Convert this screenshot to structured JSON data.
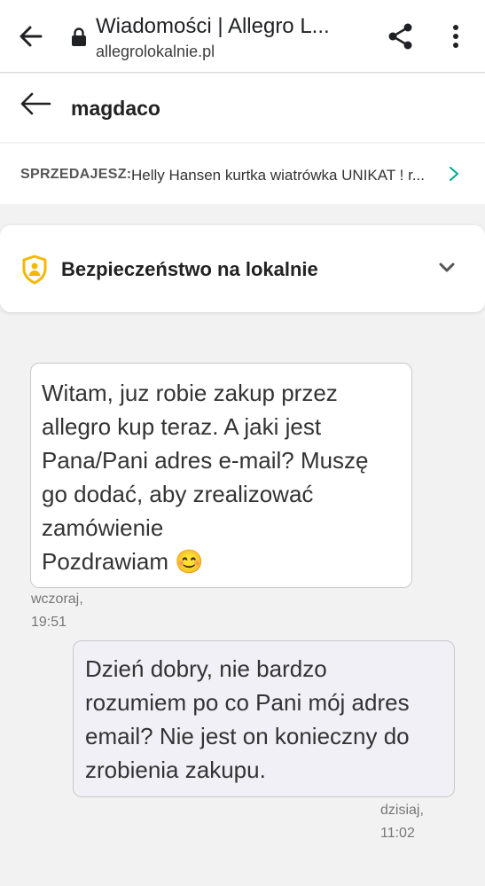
{
  "browser": {
    "title": "Wiadomości | Allegro L...",
    "url": "allegrolokalnie.pl"
  },
  "conversation": {
    "username": "magdaco"
  },
  "seller_bar": {
    "label": "SPRZEDAJESZ:",
    "item": "Helly Hansen kurtka wiatrówka UNIKAT ! r..."
  },
  "safety": {
    "title": "Bezpieczeństwo na lokalnie"
  },
  "messages": [
    {
      "direction": "incoming",
      "text": "Witam, juz robie zakup przez\nallegro kup teraz. A jaki jest\nPana/Pani adres e-mail? Muszę\ngo dodać, aby zrealizować\nzamówienie\nPozdrawiam 😊",
      "time": "wczoraj,\n19:51"
    },
    {
      "direction": "outgoing",
      "text": "Dzień dobry, nie bardzo\nrozumiem po co Pani mój adres\nemail? Nie jest on konieczny do\nzrobienia zakupu.",
      "time": "dzisiaj,\n11:02"
    }
  ],
  "colors": {
    "accent_teal": "#00a790",
    "shield_yellow": "#f5b800",
    "outgoing_bubble": "#f1f0f7",
    "background": "#f2f2f2"
  },
  "icons": {
    "browser_back": "arrow-left-icon",
    "lock": "lock-icon",
    "share": "share-icon",
    "menu": "more-vertical-icon",
    "conversation_back": "arrow-left-icon",
    "seller_chevron": "chevron-right-icon",
    "safety_shield": "shield-user-icon",
    "safety_expand": "chevron-down-icon"
  }
}
